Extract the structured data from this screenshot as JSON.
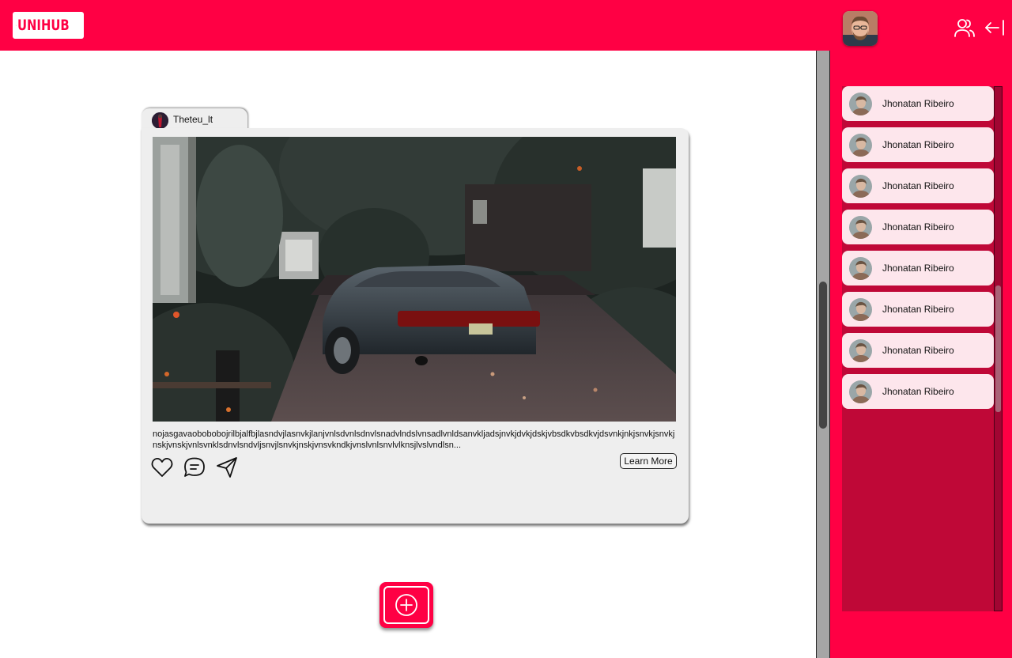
{
  "header": {
    "logo_text": "UNIHUB",
    "logo_icon": "people-logo-icon",
    "user_avatar": "user-avatar",
    "friends_icon": "users-icon",
    "collapse_icon": "arrow-left-bar-icon"
  },
  "post": {
    "author": "Theteu_lt",
    "caption": "nojasgavaobobobojrilbjalfbjlasndvjlasnvkjlanjvnlsdvnlsdnvlsnadvlndslvnsadlvnldsanvkljadsjnvkjdvkjdskjvbsdkvbsdkvjdsvnkjnkjsnvkjsnvkjnskjvnskjvnlsvnklsdnvlsndvljsnvjlsnvkjnskjvnsvkndkjvnslvnlsnvlvlknsjlvslvndlsn...",
    "learn_more_label": "Learn More",
    "icons": {
      "like": "heart-icon",
      "comment": "comment-icon",
      "share": "send-icon"
    }
  },
  "friends": [
    {
      "name": "Jhonatan Ribeiro"
    },
    {
      "name": "Jhonatan Ribeiro"
    },
    {
      "name": "Jhonatan Ribeiro"
    },
    {
      "name": "Jhonatan Ribeiro"
    },
    {
      "name": "Jhonatan Ribeiro"
    },
    {
      "name": "Jhonatan Ribeiro"
    },
    {
      "name": "Jhonatan Ribeiro"
    },
    {
      "name": "Jhonatan Ribeiro"
    }
  ],
  "add_post_icon": "plus-circle-icon",
  "colors": {
    "brand": "#ff0044",
    "panel": "#bf0837",
    "card": "#eeeeee",
    "friend_item": "#fde6ec"
  }
}
